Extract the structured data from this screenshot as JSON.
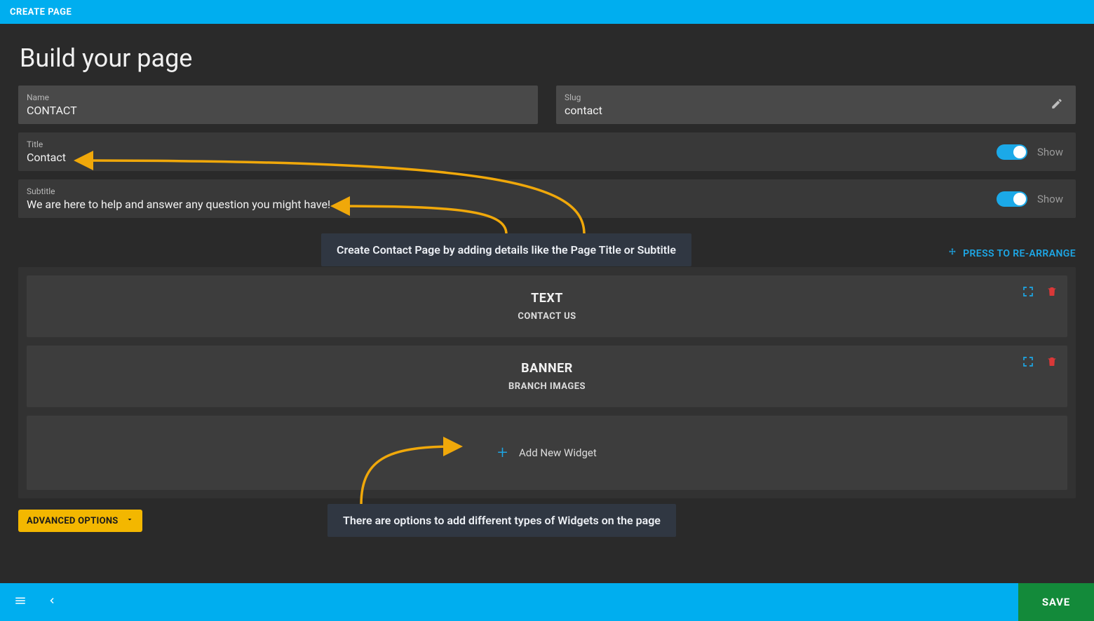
{
  "topbar": {
    "title": "CREATE PAGE"
  },
  "heading": "Build your page",
  "fields": {
    "name": {
      "label": "Name",
      "value": "CONTACT"
    },
    "slug": {
      "label": "Slug",
      "value": "contact"
    },
    "title": {
      "label": "Title",
      "value": "Contact",
      "toggle_label": "Show"
    },
    "subtitle": {
      "label": "Subtitle",
      "value": "We are here to help and answer any question you might have!",
      "toggle_label": "Show"
    }
  },
  "rearrange_label": "PRESS TO RE-ARRANGE",
  "widgets": [
    {
      "type": "TEXT",
      "name": "CONTACT US"
    },
    {
      "type": "BANNER",
      "name": "BRANCH IMAGES"
    }
  ],
  "add_widget_label": "Add New Widget",
  "advanced_options_label": "ADVANCED OPTIONS",
  "save_label": "SAVE",
  "annotations": {
    "top": "Create Contact Page by adding details like the Page Title or Subtitle",
    "bottom": "There are options to add different types of Widgets on the page"
  }
}
